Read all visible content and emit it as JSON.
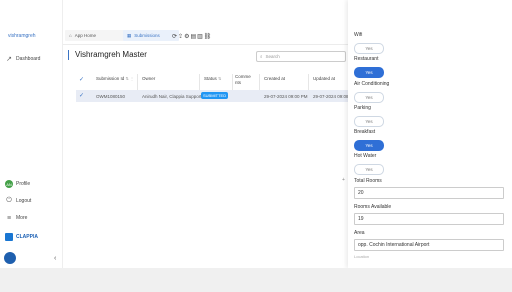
{
  "sidebar": {
    "workspace": "vishramgreh",
    "dashboard": "Dashboard",
    "profile_initials": "AN",
    "profile": "Profile",
    "logout": "Logout",
    "more": "More",
    "brand": "CLAPPIA"
  },
  "tabs": {
    "home": "App Home",
    "submissions": "Submissions"
  },
  "main": {
    "title": "Vishramgreh Master",
    "search_placeholder": "Search",
    "columns": [
      "Submission Id",
      "Owner",
      "Status",
      "Comme nts",
      "Created at",
      "Updated at"
    ],
    "row": {
      "submission_id": "OWM1080150",
      "owner": "Anirudh Nair, Clappia Support",
      "status": "SUBMITTED",
      "created": "29-07-2024 09:00 PM",
      "updated": "29-07-2024 09:08 PM"
    }
  },
  "panel": {
    "wifi": {
      "label": "Wifi",
      "value": "Yes",
      "on": false
    },
    "restaurant": {
      "label": "Restaurant",
      "value": "Yes",
      "on": true
    },
    "ac": {
      "label": "Air Conditioning",
      "value": "Yes",
      "on": false
    },
    "parking": {
      "label": "Parking",
      "value": "Yes",
      "on": false
    },
    "breakfast": {
      "label": "Breakfast",
      "value": "Yes",
      "on": true
    },
    "hotwater": {
      "label": "Hot Water",
      "value": "Yes",
      "on": false
    },
    "total_rooms": {
      "label": "Total Rooms",
      "value": "20"
    },
    "rooms_available": {
      "label": "Rooms Available",
      "value": "19"
    },
    "area": {
      "label": "Area",
      "value": "opp. Cochin International Airport"
    },
    "location_hint": "Location"
  },
  "colors": {
    "accent": "#2f6fd6",
    "badge": "#2196f3",
    "brand": "#1976d2"
  }
}
